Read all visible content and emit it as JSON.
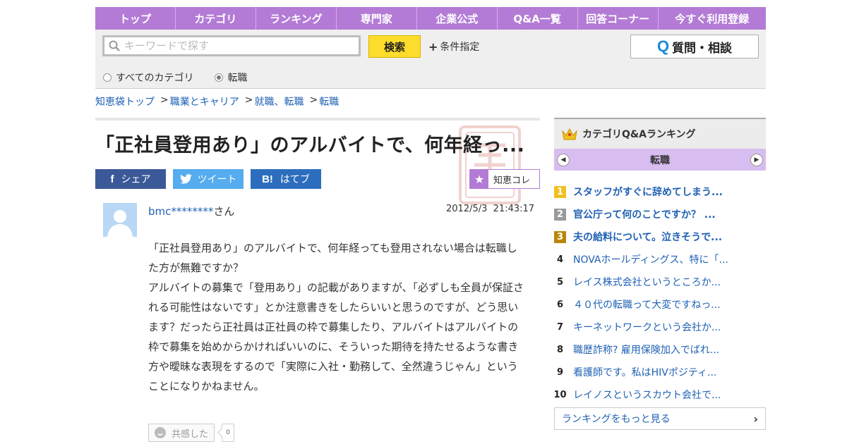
{
  "nav": [
    "トップ",
    "カテゴリ",
    "ランキング",
    "専門家",
    "企業公式",
    "Q&A一覧",
    "回答コーナー",
    "今すぐ利用登録"
  ],
  "search": {
    "placeholder": "キーワードで探す",
    "button": "検索",
    "conditions": "条件指定",
    "ask_button": "質問・相談",
    "ask_icon": "Q",
    "scope_all": "すべてのカテゴリ",
    "scope_current": "転職",
    "selected_scope": "転職"
  },
  "breadcrumb": [
    "知恵袋トップ",
    "職業とキャリア",
    "就職、転職",
    "転職"
  ],
  "breadcrumb_sep": ">",
  "question": {
    "title": "「正社員登用あり」のアルバイトで、何年経っ...",
    "user": "bmc********",
    "user_suffix": "さん",
    "date": "2012/5/3",
    "time": "21:43:17",
    "body": [
      "「正社員登用あり」のアルバイトで、何年経っても登用されない場合は転職した方が無難ですか？",
      "アルバイトの募集で「登用あり」の記載がありますが、「必ずしも全員が保証される可能性はないです」とか注意書きをしたらいいと思うのですが、どう思います？だったら正社員は正社員の枠で募集したり、アルバイトはアルバイトの枠で募集を始めからかければいいのに、そういった期待を持たせるような書き方や曖昧な表現をするので「実際に入社・勤務して、全然違うじゃん」ということになりかねません。"
    ],
    "empathy_label": "共感した",
    "empathy_count": "0"
  },
  "share": {
    "facebook": "シェア",
    "facebook_icon": "f",
    "twitter": "ツイート",
    "hatena": "はてブ",
    "hatena_icon": "B!",
    "chiekore": "知恵コレ",
    "chiekore_icon": "★"
  },
  "sidebar": {
    "title": "カテゴリQ&Aランキング",
    "category": "転職",
    "prev_icon": "◀",
    "next_icon": "▶",
    "ranking": [
      {
        "rank": "1",
        "text": "スタッフがすぐに辞めてしまう...",
        "badge_color": "#f0c020"
      },
      {
        "rank": "2",
        "text": "官公庁って何のことですか？ ...",
        "badge_color": "#9a9a9a"
      },
      {
        "rank": "3",
        "text": "夫の給料について。泣きそうで...",
        "badge_color": "#b8860b"
      },
      {
        "rank": "4",
        "text": "NOVAホールディングス、特に「..."
      },
      {
        "rank": "5",
        "text": "レイス株式会社というところか..."
      },
      {
        "rank": "6",
        "text": "４０代の転職って大変ですねっ..."
      },
      {
        "rank": "7",
        "text": "キーネットワークという会社か..."
      },
      {
        "rank": "8",
        "text": "職歴詐称? 雇用保険加入でばれ..."
      },
      {
        "rank": "9",
        "text": "看護師です。私はHIVポジティ..."
      },
      {
        "rank": "10",
        "text": "レイノスというスカウト会社で..."
      }
    ],
    "more": "ランキングをもっと見る",
    "more_icon": "›"
  },
  "colors": {
    "nav": "#b37bd6",
    "link": "#2061b5",
    "search_button": "#fddc2b",
    "category_bar": "#d7bdf0"
  }
}
